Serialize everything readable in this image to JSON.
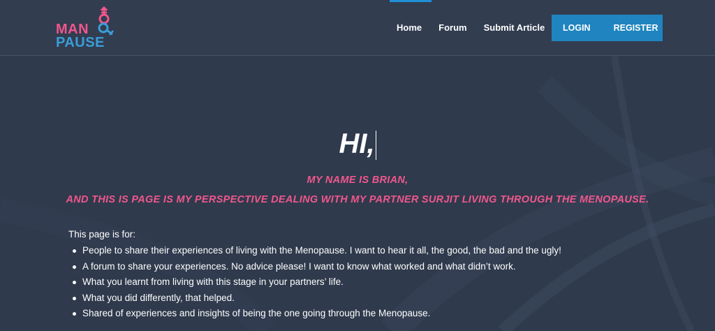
{
  "header": {
    "logo": {
      "word_top": "MAN",
      "word_bottom": "PAUSE",
      "colors": {
        "pink": "#f0568c",
        "blue": "#3a9ed8"
      },
      "symbol_icon": "male-female-gender-icon"
    },
    "nav": [
      {
        "label": "Home",
        "active": true
      },
      {
        "label": "Forum"
      },
      {
        "label": "Submit Article"
      }
    ],
    "auth": {
      "login": "LOGIN",
      "register": "REGISTER",
      "color": "#1f84bf"
    }
  },
  "hero": {
    "greeting": "HI,",
    "tagline_1": "MY NAME IS BRIAN,",
    "tagline_2": "AND THIS IS PAGE IS MY PERSPECTIVE DEALING WITH MY PARTNER SURJIT LIVING THROUGH THE MENOPAUSE.",
    "tagline_color": "#f0578d"
  },
  "content": {
    "intro": "This page is for:",
    "items": [
      "People to share their experiences of living with the Menopause. I want to hear it all, the good, the bad and the ugly!",
      "A forum to share your experiences. No advice please! I want to know what worked and what didn’t work.",
      "What you learnt from living with this stage in your partners’ life.",
      "What you did differently, that helped.",
      "Shared of experiences and insights of being the one going through the Menopause."
    ]
  },
  "theme": {
    "background": "#2f3a4c",
    "header_bg": "#323d50",
    "accent": "#1f8fd6"
  }
}
